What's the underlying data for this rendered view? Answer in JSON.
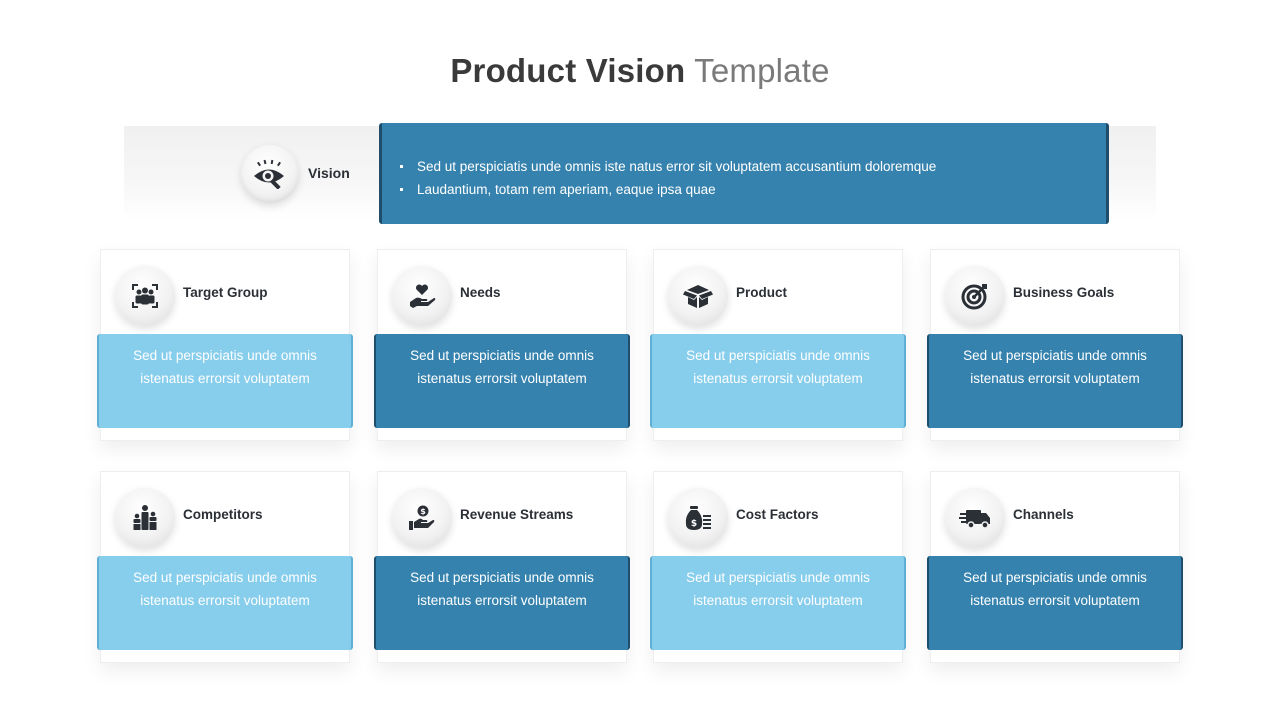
{
  "title": {
    "bold": "Product Vision",
    "light": "Template"
  },
  "vision": {
    "label": "Vision",
    "icon": "eye-search-icon",
    "bullets": [
      "Sed ut perspiciatis  unde omnis iste natus error sit voluptatem accusantium  doloremque",
      "Laudantium,  totam rem aperiam,  eaque  ipsa quae"
    ]
  },
  "colors": {
    "dark_blue": "#3582ae",
    "light_blue": "#87cdec",
    "title_dark": "#3a3a3a",
    "title_light": "#7a7a7a"
  },
  "cards": [
    {
      "label": "Target Group",
      "icon": "target-group-icon",
      "text": "Sed ut perspiciatis  unde omnis istenatus errorsit voluptatem",
      "style": "light"
    },
    {
      "label": "Needs",
      "icon": "heart-hand-icon",
      "text": "Sed ut perspiciatis  unde omnis istenatus errorsit voluptatem",
      "style": "dark"
    },
    {
      "label": "Product",
      "icon": "box-icon",
      "text": "Sed ut perspiciatis  unde omnis istenatus errorsit voluptatem",
      "style": "light"
    },
    {
      "label": "Business  Goals",
      "icon": "target-arrow-icon",
      "text": "Sed ut perspiciatis  unde omnis istenatus errorsit voluptatem",
      "style": "dark"
    },
    {
      "label": "Competitors",
      "icon": "podium-people-icon",
      "text": "Sed ut perspiciatis  unde omnis istenatus errorsit voluptatem",
      "style": "light"
    },
    {
      "label": "Revenue  Streams",
      "icon": "coin-hand-icon",
      "text": "Sed ut perspiciatis  unde omnis istenatus errorsit voluptatem",
      "style": "dark"
    },
    {
      "label": "Cost Factors",
      "icon": "money-bag-icon",
      "text": "Sed ut perspiciatis  unde omnis istenatus errorsit voluptatem",
      "style": "light"
    },
    {
      "label": "Channels",
      "icon": "delivery-truck-icon",
      "text": "Sed ut perspiciatis  unde omnis istenatus errorsit voluptatem",
      "style": "dark"
    }
  ]
}
